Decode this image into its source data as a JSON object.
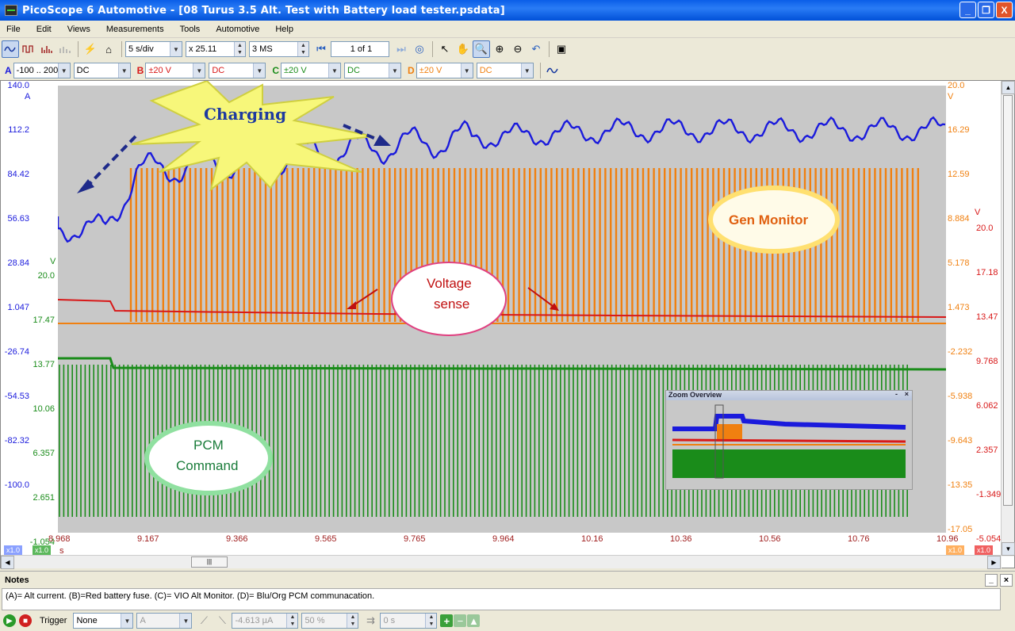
{
  "window": {
    "title": "PicoScope 6 Automotive - [08 Turus 3.5 Alt.  Test with Battery load tester.psdata]",
    "buttons": [
      "_",
      "❐",
      "X"
    ]
  },
  "menu": [
    "File",
    "Edit",
    "Views",
    "Measurements",
    "Tools",
    "Automotive",
    "Help"
  ],
  "toolbar": {
    "timebase": "5 s/div",
    "zoom": "x 25.11",
    "samples": "3 MS",
    "page": "1  of 1"
  },
  "channels": [
    {
      "id": "A",
      "range": "-100 .. 200",
      "coupling": "DC",
      "color": "#1a1adc"
    },
    {
      "id": "B",
      "range": "±20 V",
      "coupling": "DC",
      "color": "#d81818"
    },
    {
      "id": "C",
      "range": "±20 V",
      "coupling": "DC",
      "color": "#1a8c1a"
    },
    {
      "id": "D",
      "range": "±20 V",
      "coupling": "DC",
      "color": "#f08010"
    }
  ],
  "axes": {
    "a_unit": "A",
    "a_ticks": [
      "140.0",
      "112.2",
      "84.42",
      "56.63",
      "28.84",
      "1.047",
      "-26.74",
      "-54.53",
      "-82.32",
      "-100.0"
    ],
    "c_unit": "V",
    "c_ticks": [
      "20.0",
      "17.47",
      "13.77",
      "10.06",
      "6.357",
      "2.651",
      "-1.054"
    ],
    "d_unit": "V",
    "d_ticks": [
      "20.0",
      "16.29",
      "12.59",
      "8.884",
      "5.178",
      "1.473",
      "-2.232",
      "-5.938",
      "-9.643",
      "-13.35",
      "-17.05"
    ],
    "b_unit": "V",
    "b_ticks": [
      "20.0",
      "17.18",
      "13.47",
      "9.768",
      "6.062",
      "2.357",
      "-1.349",
      "-5.054"
    ],
    "x_ticks": [
      "8.968",
      "9.167",
      "9.366",
      "9.565",
      "9.765",
      "9.964",
      "10.16",
      "10.36",
      "10.56",
      "10.76",
      "10.96"
    ],
    "x_unit": "s",
    "scale_tags": [
      "x1.0",
      "x1.0",
      "x1.0",
      "x1.0"
    ]
  },
  "annotations": {
    "charging": "Charging",
    "gen_monitor": "Gen Monitor",
    "voltage_sense_1": "Voltage",
    "voltage_sense_2": "sense",
    "pcm_1": "PCM",
    "pcm_2": "Command"
  },
  "zoom_overview": {
    "title": "Zoom Overview"
  },
  "notes": {
    "header": "Notes",
    "text": "(A)= Alt current. (B)=Red battery fuse. (C)= VIO Alt Monitor. (D)= Blu/Org PCM communacation."
  },
  "statusbar": {
    "trigger_label": "Trigger",
    "trigger_mode": "None",
    "trigger_channel": "A",
    "threshold": "-4.613 µA",
    "pretrigger": "50 %",
    "delay": "0 s"
  }
}
